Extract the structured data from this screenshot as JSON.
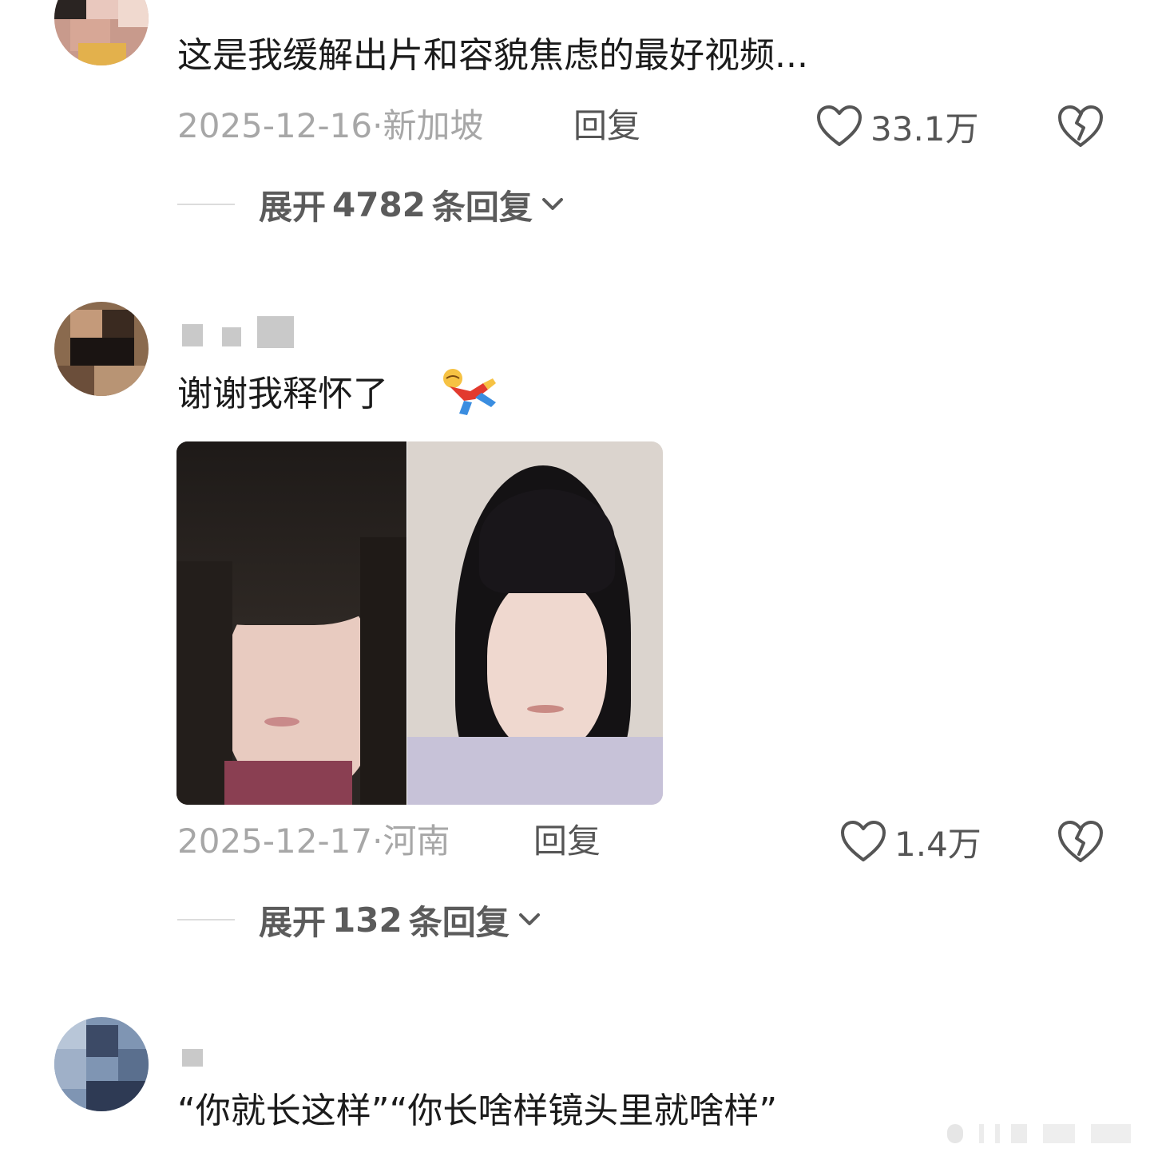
{
  "comments": [
    {
      "text": "这是我缓解出片和容貌焦虑的最好视频...",
      "date": "2025-12-16",
      "location": "新加坡",
      "reply_label": "回复",
      "likes": "33.1万",
      "expand": {
        "prefix": "展开",
        "count": "4782",
        "suffix": "条回复"
      }
    },
    {
      "text": "谢谢我释怀了",
      "emoji": "cartwheel-emoji",
      "date": "2025-12-17",
      "location": "河南",
      "reply_label": "回复",
      "likes": "1.4万",
      "expand": {
        "prefix": "展开",
        "count": "132",
        "suffix": "条回复"
      }
    },
    {
      "text": "“你就长这样”“你长啥样镜头里就啥样”"
    }
  ],
  "icons": {
    "like": "heart-outline-icon",
    "dislike": "broken-heart-icon",
    "expand": "chevron-down-icon"
  },
  "colors": {
    "text": "#1b1b1b",
    "meta": "#a7a7a7",
    "action": "#555555",
    "expand": "#5b5b5b"
  }
}
